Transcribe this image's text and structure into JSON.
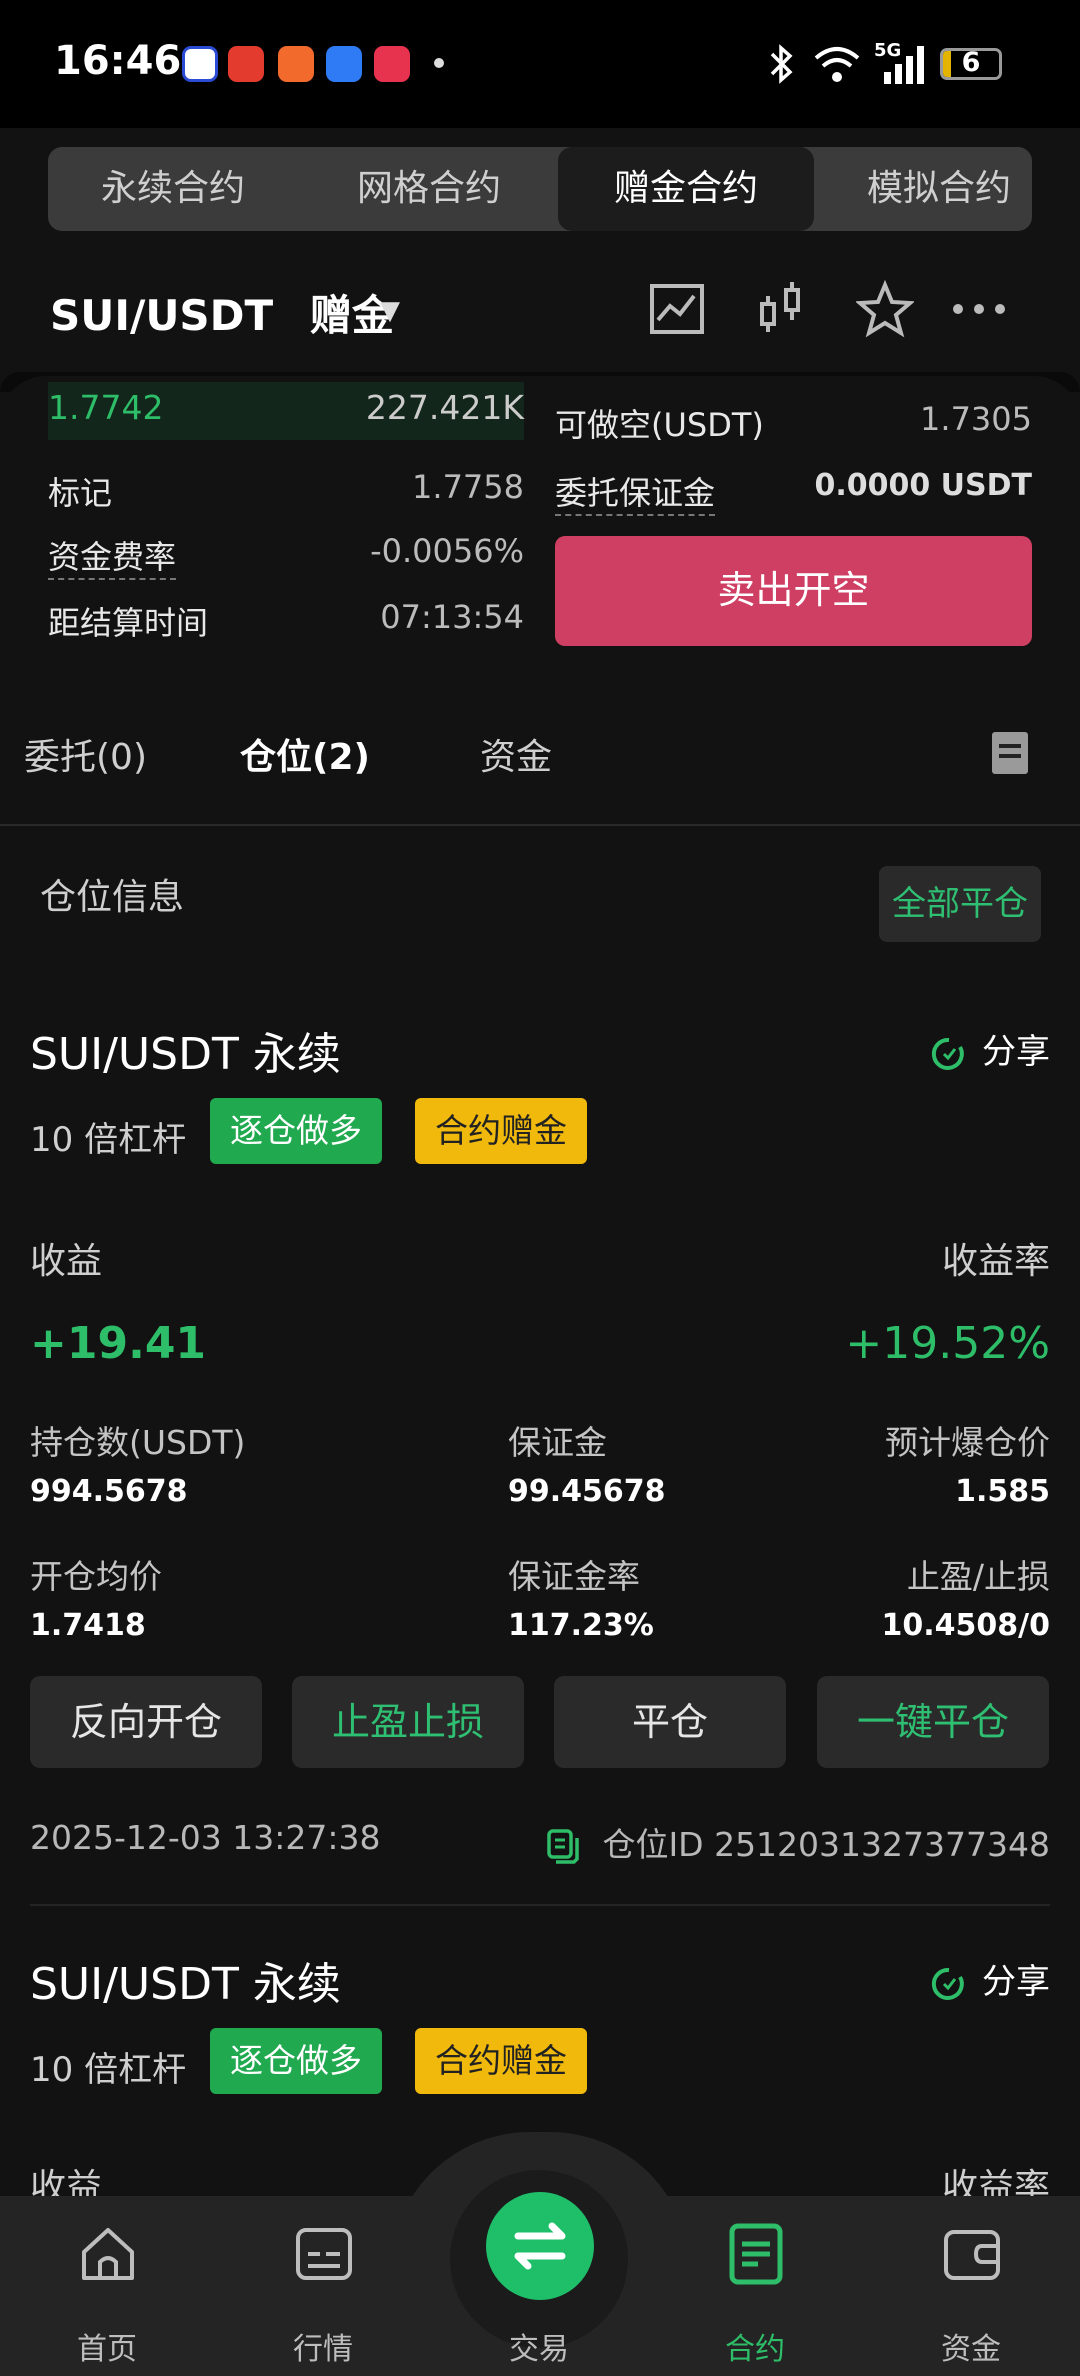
{
  "status_bar": {
    "time": "16:46",
    "network": "5G",
    "battery": "6"
  },
  "contract_tabs": [
    {
      "label": "永续合约",
      "active": false
    },
    {
      "label": "网格合约",
      "active": false
    },
    {
      "label": "赠金合约",
      "active": true
    },
    {
      "label": "模拟合约",
      "active": false
    }
  ],
  "header": {
    "pair": "SUI/USDT",
    "mode": "赠金"
  },
  "orderbook": {
    "price": "1.7742",
    "amount": "227.421K"
  },
  "info": {
    "mark_label": "标记",
    "mark_value": "1.7758",
    "funding_label": "资金费率",
    "funding_value": "-0.0056%",
    "settle_label": "距结算时间",
    "settle_value": "07:13:54"
  },
  "order_side": {
    "short_avail_label": "可做空(USDT)",
    "short_avail_value": "1.7305",
    "margin_label": "委托保证金",
    "margin_value": "0.0000 USDT",
    "sell_button": "卖出开空"
  },
  "sub_tabs": [
    {
      "label": "委托(0)",
      "active": false
    },
    {
      "label": "仓位(2)",
      "active": true
    },
    {
      "label": "资金",
      "active": false
    }
  ],
  "positions_header": {
    "title": "仓位信息",
    "close_all": "全部平仓"
  },
  "positions": [
    {
      "title": "SUI/USDT 永续",
      "share": "分享",
      "leverage": "10 倍杠杆",
      "badge_mode": "逐仓做多",
      "badge_bonus": "合约赠金",
      "pnl_label": "收益",
      "pnl_value": "+19.41",
      "roi_label": "收益率",
      "roi_value": "+19.52%",
      "size_label": "持仓数(USDT)",
      "size_value": "994.5678",
      "margin_label": "保证金",
      "margin_value": "99.45678",
      "liq_label": "预计爆仓价",
      "liq_value": "1.585",
      "entry_label": "开仓均价",
      "entry_value": "1.7418",
      "margin_ratio_label": "保证金率",
      "margin_ratio_value": "117.23%",
      "tpsl_label": "止盈/止损",
      "tpsl_value": "10.4508/0",
      "btn_reverse": "反向开仓",
      "btn_tpsl": "止盈止损",
      "btn_close": "平仓",
      "btn_oneclick": "一键平仓",
      "time": "2025-12-03 13:27:38",
      "position_id": "仓位ID 2512031327377348"
    },
    {
      "title": "SUI/USDT 永续",
      "share": "分享",
      "leverage": "10 倍杠杆",
      "badge_mode": "逐仓做多",
      "badge_bonus": "合约赠金",
      "pnl_label": "收益",
      "roi_label": "收益率"
    }
  ],
  "bottom_nav": [
    {
      "label": "首页",
      "icon": "home-icon"
    },
    {
      "label": "行情",
      "icon": "market-icon"
    },
    {
      "label": "交易",
      "icon": "swap-icon"
    },
    {
      "label": "合约",
      "icon": "contract-icon",
      "active": true
    },
    {
      "label": "资金",
      "icon": "wallet-icon"
    }
  ],
  "colors": {
    "accent_green": "#2ebd68",
    "sell_red": "#cf3f63",
    "bonus_yellow": "#f0b90b"
  }
}
